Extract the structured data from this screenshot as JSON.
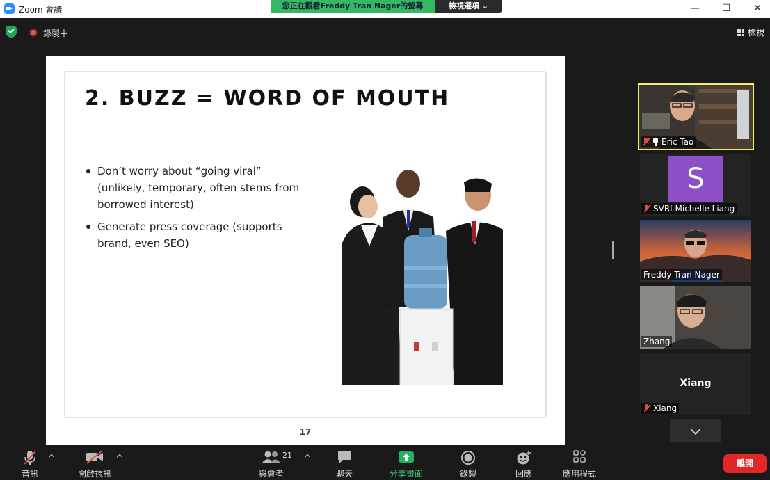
{
  "window": {
    "title": "Zoom 會議",
    "share_banner": "您正在觀看Freddy Tran Nager的螢幕",
    "view_options": "檢視選項",
    "minimize": "—",
    "maximize": "☐",
    "close": "✕"
  },
  "meeting_bar": {
    "recording": "錄製中",
    "view": "檢視"
  },
  "slide": {
    "title": "2. BUZZ = WORD OF MOUTH",
    "bullets": [
      "Don’t worry about “going viral” (unlikely, temporary, often stems from borrowed interest)",
      "Generate press coverage (supports brand, even SEO)"
    ],
    "page_number": "17"
  },
  "participants": [
    {
      "name": "Eric Tao",
      "muted": true,
      "pinned": true,
      "active_speaker": true
    },
    {
      "name": "SVRI Michelle Liang",
      "muted": true,
      "avatar_letter": "S",
      "avatar_color": "#8d4fc6"
    },
    {
      "name": "Freddy Tran Nager",
      "muted": false
    },
    {
      "name": "Zhang",
      "muted": false
    },
    {
      "name": "Xiang",
      "muted": true,
      "display_name_center": "Xiang"
    }
  ],
  "toolbar": {
    "audio": "音訊",
    "video": "開啟視訊",
    "participants": "與會者",
    "participants_count": "21",
    "chat": "聊天",
    "share": "分享畫面",
    "record": "錄製",
    "reactions": "回應",
    "apps": "應用程式",
    "leave": "離開"
  },
  "colors": {
    "share_green": "#35b765",
    "leave_red": "#e02828",
    "active_border": "#f2f06a"
  }
}
